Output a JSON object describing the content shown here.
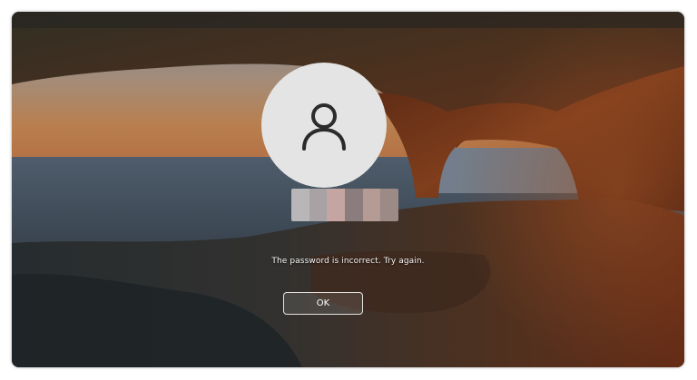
{
  "lock_screen": {
    "user_icon": "person-outline-icon",
    "message": "The password is incorrect. Try again.",
    "ok_label": "OK"
  },
  "colors": {
    "avatar_bg": "#e4e4e4",
    "icon_stroke": "#2b2b2b",
    "text": "#f2f2f2"
  }
}
